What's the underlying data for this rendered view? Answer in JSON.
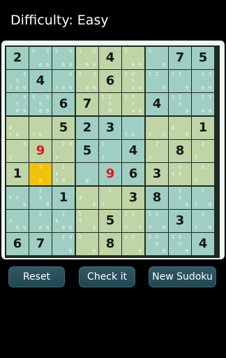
{
  "header": {
    "title": "Difficulty: Easy"
  },
  "colors": {
    "cell_a": "#9fcfc3",
    "cell_b": "#bfd5a6",
    "selected": "#f2c208",
    "given_digit": "#151515",
    "user_digit": "#e01818",
    "candidate": "#f4f8f4",
    "grid_line": "#1e2a22"
  },
  "board": {
    "selected": [
      5,
      1
    ],
    "values": [
      [
        "2",
        "",
        "",
        "",
        "4",
        "",
        "",
        "7",
        "5"
      ],
      [
        "",
        "4",
        "",
        "",
        "6",
        "",
        "",
        "",
        ""
      ],
      [
        "",
        "",
        "6",
        "7",
        "",
        "",
        "4",
        "",
        ""
      ],
      [
        "",
        "",
        "5",
        "2",
        "3",
        "",
        "",
        "",
        "1"
      ],
      [
        "",
        "9",
        "",
        "5",
        "",
        "4",
        "",
        "8",
        ""
      ],
      [
        "1",
        "",
        "",
        "",
        "9",
        "6",
        "3",
        "",
        ""
      ],
      [
        "",
        "",
        "1",
        "",
        "",
        "3",
        "8",
        "",
        ""
      ],
      [
        "",
        "",
        "",
        "",
        "5",
        "",
        "",
        "3",
        ""
      ],
      [
        "6",
        "7",
        "",
        "",
        "8",
        "",
        "",
        "",
        "4"
      ]
    ],
    "user_entered": [
      [
        4,
        1
      ],
      [
        5,
        4
      ]
    ],
    "candidates": [
      [
        "",
        "1,3,8,9",
        "1,3,8,9",
        "1,3,8,9",
        "",
        "1,8,9",
        "1,9",
        "",
        ""
      ],
      [
        "3,5,7,8,9",
        "",
        "3,7,8,9",
        "1,3,8,9",
        "",
        "1,2,5,8,9",
        "1,2,9",
        "1,2,9",
        "2,3,8,9"
      ],
      [
        "3,5,8,9",
        "1,3,5,8,9",
        "",
        "",
        "1,2,5,8",
        "1,2,5,8,9",
        "",
        "1,2,5,9",
        "2,3,8,9"
      ],
      [
        "4,7,8",
        "7,8",
        "",
        "",
        "",
        "7,8",
        "7,9",
        "4,9",
        ""
      ],
      [
        "3,7",
        "",
        "2,3,7",
        "",
        "1,7",
        "",
        "2,7",
        "",
        "2,7"
      ],
      [
        "",
        "2,8",
        "2,4,7,8",
        "8",
        "",
        "",
        "",
        "2,4,5",
        "2,7"
      ],
      [
        "4,5,9",
        "2,5,9",
        "",
        "4,9",
        "2,7",
        "",
        "",
        "2,5,9",
        "2,7,9"
      ],
      [
        "4,8,9",
        "2,8,9",
        "2,4,8,9",
        "1,4,9",
        "",
        "1,2,7,9",
        "1,2,7,9",
        "",
        "2,7,9"
      ],
      [
        "",
        "",
        "2,3,9",
        "1,9",
        "",
        "1,2,9",
        "1,2,5,9",
        "1,2,5,9",
        ""
      ]
    ]
  },
  "buttons": {
    "reset": "Reset",
    "check": "Check it",
    "new_sudoku": "New Sudoku"
  }
}
